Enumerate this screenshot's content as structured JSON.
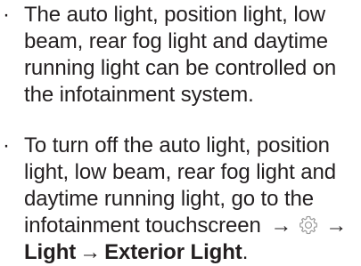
{
  "bullets": [
    {
      "marker": "·",
      "text": "The auto light, position light, low beam, rear fog light and daytime running light can be controlled on the infotainment system."
    },
    {
      "marker": "·",
      "text_prefix": "To turn off the auto light, position light, low beam, rear fog light and daytime running light, go to the infotainment touchscreen",
      "arrow_1": "→",
      "icon": "gear-icon",
      "arrow_2": "→",
      "menu_light": "Light",
      "arrow_3": "→",
      "menu_exterior_light": "Exterior Light",
      "end_punct": "."
    }
  ]
}
